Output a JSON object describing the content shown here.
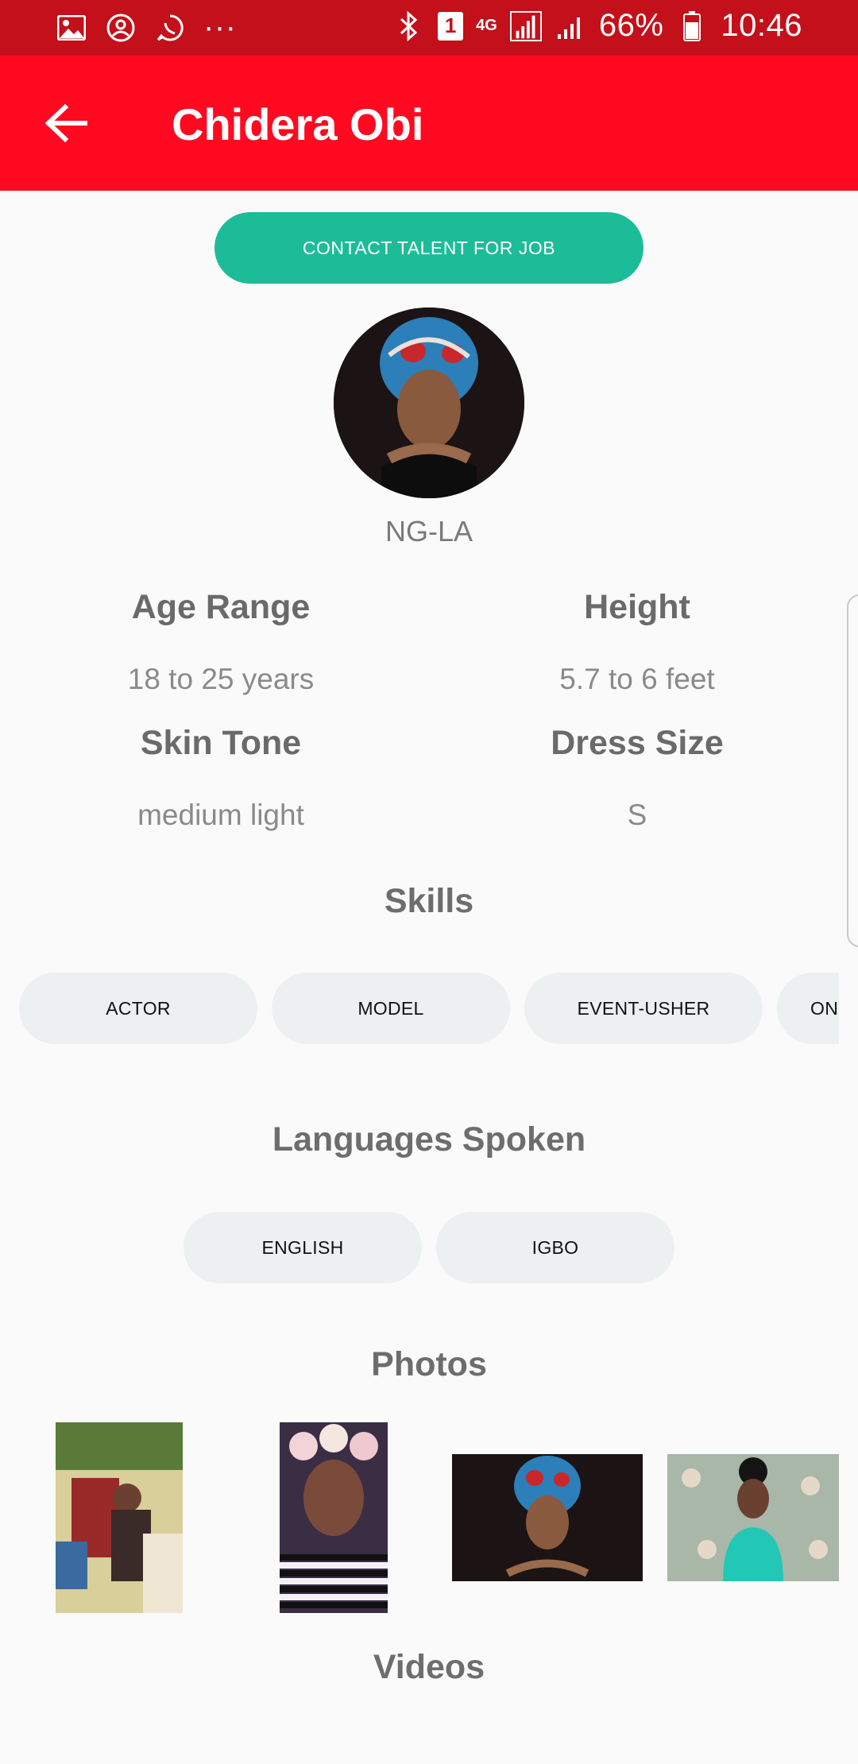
{
  "status_bar": {
    "network": "4G",
    "sim_badge": "1",
    "battery": "66%",
    "time": "10:46",
    "more": "···"
  },
  "app_bar": {
    "title": "Chidera Obi"
  },
  "contact_button": "CONTACT TALENT FOR JOB",
  "profile": {
    "location": "NG-LA"
  },
  "attributes": [
    {
      "label": "Age Range",
      "value": "18 to 25 years"
    },
    {
      "label": "Height",
      "value": "5.7 to 6 feet"
    },
    {
      "label": "Skin Tone",
      "value": "medium light"
    },
    {
      "label": "Dress Size",
      "value": "S"
    }
  ],
  "skills": {
    "title": "Skills",
    "items": [
      "ACTOR",
      "MODEL",
      "EVENT-USHER",
      "ON-"
    ]
  },
  "languages": {
    "title": "Languages Spoken",
    "items": [
      "ENGLISH",
      "IGBO"
    ]
  },
  "photos": {
    "title": "Photos"
  },
  "videos": {
    "title": "Videos"
  },
  "colors": {
    "status_bar": "#c4101a",
    "app_bar": "#ff0a20",
    "accent_button": "#1dbc98",
    "chip_bg": "#edf0f1",
    "background": "#fafafa"
  }
}
